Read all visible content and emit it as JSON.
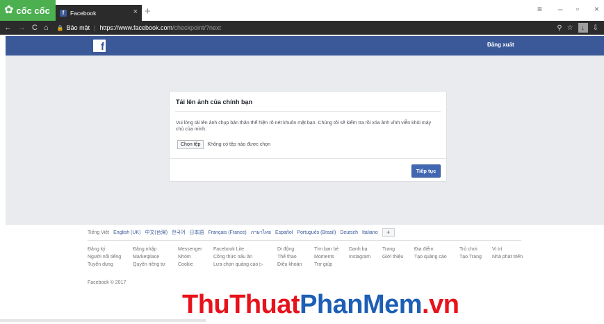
{
  "browser": {
    "brand": "cốc cốc",
    "tab_title": "Facebook",
    "tab_favicon": "f",
    "address": {
      "security_label": "Bảo mật",
      "url_host": "https://www.facebook.com",
      "url_path": "/checkpoint/?next"
    }
  },
  "header": {
    "logo": "f",
    "logout_label": "Đăng xuất"
  },
  "card": {
    "title": "Tải lên ảnh của chính bạn",
    "description": "Vui lòng tải lên ảnh chụp bản thân thể hiện rõ nét khuôn mặt bạn. Chúng tôi sẽ kiểm tra rồi xóa ảnh vĩnh viễn khỏi máy chủ của mình.",
    "choose_file_label": "Chọn tệp",
    "no_file_text": "Không có tệp nào được chọn",
    "continue_label": "Tiếp tục"
  },
  "footer": {
    "languages": [
      "Tiếng Việt",
      "English (UK)",
      "中文(台灣)",
      "한국어",
      "日本語",
      "Français (France)",
      "ภาษาไทย",
      "Español",
      "Português (Brasil)",
      "Deutsch",
      "Italiano"
    ],
    "more_languages": "+",
    "link_columns": [
      [
        "Đăng ký",
        "Người nổi tiếng",
        "Tuyển dụng"
      ],
      [
        "Đăng nhập",
        "Marketplace",
        "Quyền riêng tư"
      ],
      [
        "Messenger",
        "Nhóm",
        "Cookie"
      ],
      [
        "Facebook Lite",
        "Công thức nấu ăn",
        "Lựa chọn quảng cáo ▷"
      ],
      [
        "Di động",
        "Thể thao",
        "Điều khoản"
      ],
      [
        "Tìm bạn bè",
        "Moments",
        "Trợ giúp"
      ],
      [
        "Danh bạ",
        "Instagram"
      ],
      [
        "Trang",
        "Giới thiệu"
      ],
      [
        "Địa điểm",
        "Tạo quảng cáo"
      ],
      [
        "Trò chơi",
        "Tạo Trang"
      ],
      [
        "Vị trí",
        "Nhà phát triển"
      ]
    ],
    "copyright": "Facebook © 2017"
  },
  "watermark": {
    "part1": "ThuThuat",
    "part2": "PhanMem",
    "part3": ".vn"
  },
  "colors": {
    "facebook_blue": "#3b5998",
    "page_gray": "#e9ebee",
    "button_blue": "#4267b2",
    "coccoc_green": "#4caf50",
    "watermark_red": "#e8121b",
    "watermark_blue": "#1c5fb5"
  }
}
